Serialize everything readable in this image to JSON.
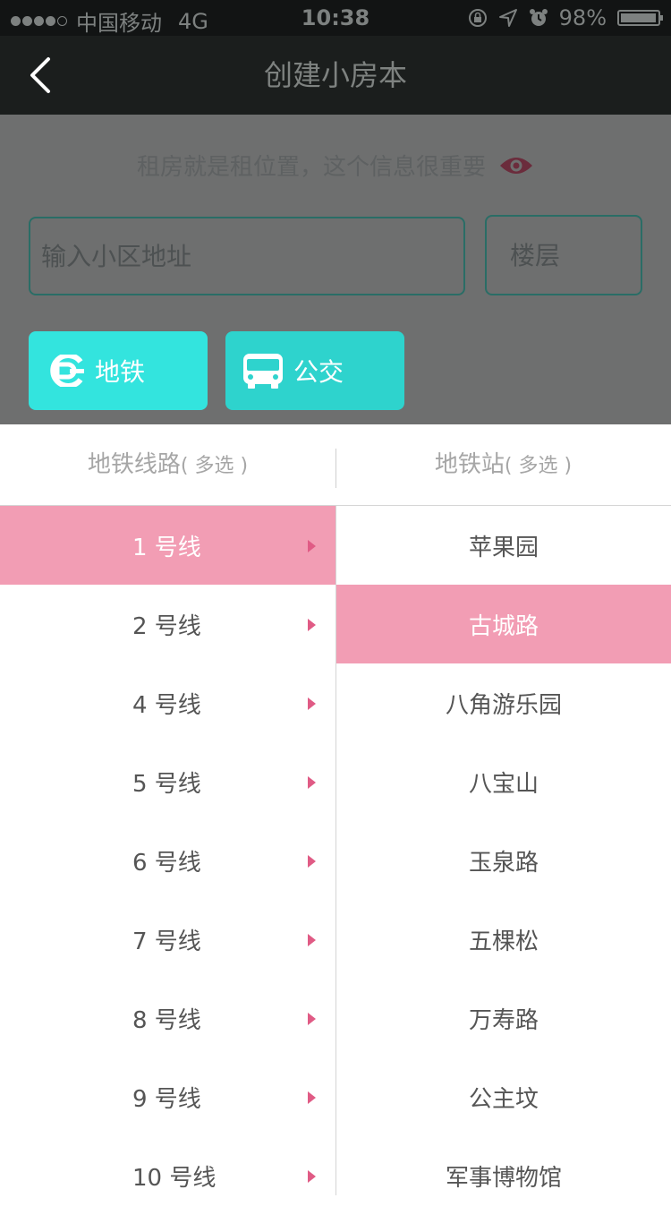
{
  "status_bar": {
    "carrier": "中国移动",
    "network": "4G",
    "time": "10:38",
    "battery": "98%",
    "battery_level": 0.98,
    "signal_filled": 4,
    "signal_total": 5
  },
  "nav": {
    "title": "创建小房本",
    "back_icon": "chevron-left-icon"
  },
  "form": {
    "hint": "租房就是租位置，这个信息很重要",
    "hint_icon": "eye-icon",
    "address_placeholder": "输入小区地址",
    "floor_placeholder": "楼层",
    "subway_label": "地铁",
    "bus_label": "公交"
  },
  "picker": {
    "lines_title": "地铁线路",
    "lines_sub": "( 多选 )",
    "stations_title": "地铁站",
    "stations_sub": "( 多选 )",
    "lines": [
      "1 号线",
      "2 号线",
      "4 号线",
      "5 号线",
      "6 号线",
      "7 号线",
      "8 号线",
      "9 号线",
      "10 号线"
    ],
    "selected_line": "1 号线",
    "stations": [
      "苹果园",
      "古城路",
      "八角游乐园",
      "八宝山",
      "玉泉路",
      "五棵松",
      "万寿路",
      "公主坟",
      "军事博物馆"
    ],
    "selected_station": "古城路"
  },
  "colors": {
    "accent_pink": "#f29db4",
    "arrow_pink": "#e05b85",
    "teal": "#33e4de",
    "teal_dark": "#2ed3cd"
  }
}
